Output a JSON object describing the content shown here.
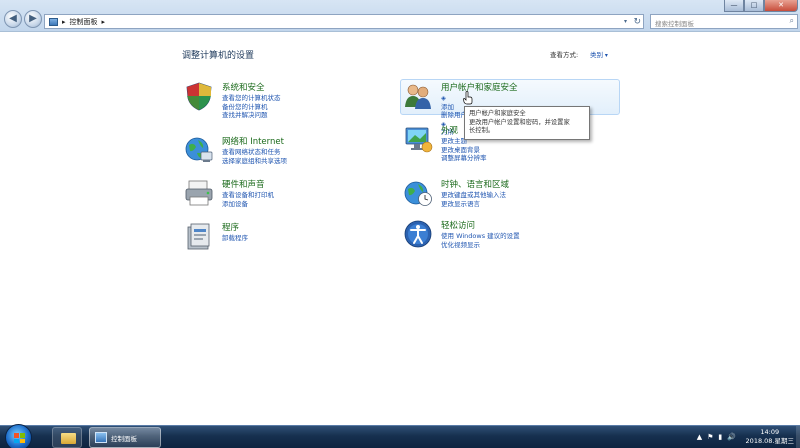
{
  "window": {
    "address": {
      "separator": "▸",
      "location": "控制面板",
      "location_separator": "▸",
      "dropdown": "▾",
      "refresh": "↻"
    },
    "search": {
      "placeholder": "搜索控制面板",
      "icon": "magnifier-icon"
    },
    "controls": {
      "minimize": "—",
      "maximize": "□",
      "close": "✕"
    },
    "nav": {
      "back": "◀",
      "forward": "▶"
    }
  },
  "page": {
    "title": "调整计算机的设置",
    "view_by_label": "查看方式:",
    "view_by_value": "类别"
  },
  "categories": {
    "system": {
      "title": "系统和安全",
      "links": [
        "查看您的计算机状态",
        "备份您的计算机",
        "查找并解决问题"
      ],
      "icon": "shield-icon"
    },
    "network": {
      "title": "网络和 Internet",
      "links": [
        "查看网络状态和任务",
        "选择家庭组和共享选项"
      ],
      "icon": "globe-network-icon"
    },
    "hardware": {
      "title": "硬件和声音",
      "links": [
        "查看设备和打印机",
        "添加设备"
      ],
      "icon": "printer-icon"
    },
    "programs": {
      "title": "程序",
      "links": [
        "卸载程序"
      ],
      "icon": "programs-icon"
    },
    "user": {
      "title": "用户帐户和家庭安全",
      "links": [
        "添加或删除用户帐户",
        "为所有用户设置家长控制"
      ],
      "link_visible": [
        "添加",
        "删除用户帐户",
        "为所"
      ],
      "icon": "users-icon"
    },
    "appearance": {
      "title": "外观和个性化",
      "title_visible": "外观",
      "links": [
        "更改主题",
        "更改桌面背景",
        "调整屏幕分辨率"
      ],
      "icon": "appearance-icon"
    },
    "clock": {
      "title": "时钟、语言和区域",
      "links": [
        "更改键盘或其他输入法",
        "更改显示语言"
      ],
      "icon": "clock-globe-icon"
    },
    "ease": {
      "title": "轻松访问",
      "links": [
        "使用 Windows 建议的设置",
        "优化视频显示"
      ],
      "icon": "ease-of-access-icon"
    }
  },
  "tooltip": {
    "lines": [
      "用户帐户和家庭安全",
      "更改用户帐户设置和密码，并设置家",
      "长控制。"
    ]
  },
  "taskbar": {
    "active_window": "控制面板",
    "tray_icons": [
      "▲",
      "⚑",
      "▮",
      "🔊"
    ],
    "time": "14:09",
    "date": "2018.08.星期三"
  },
  "colors": {
    "link": "#1f55b0",
    "category_title": "#1b6a1b",
    "taskbar": "#16304f"
  }
}
